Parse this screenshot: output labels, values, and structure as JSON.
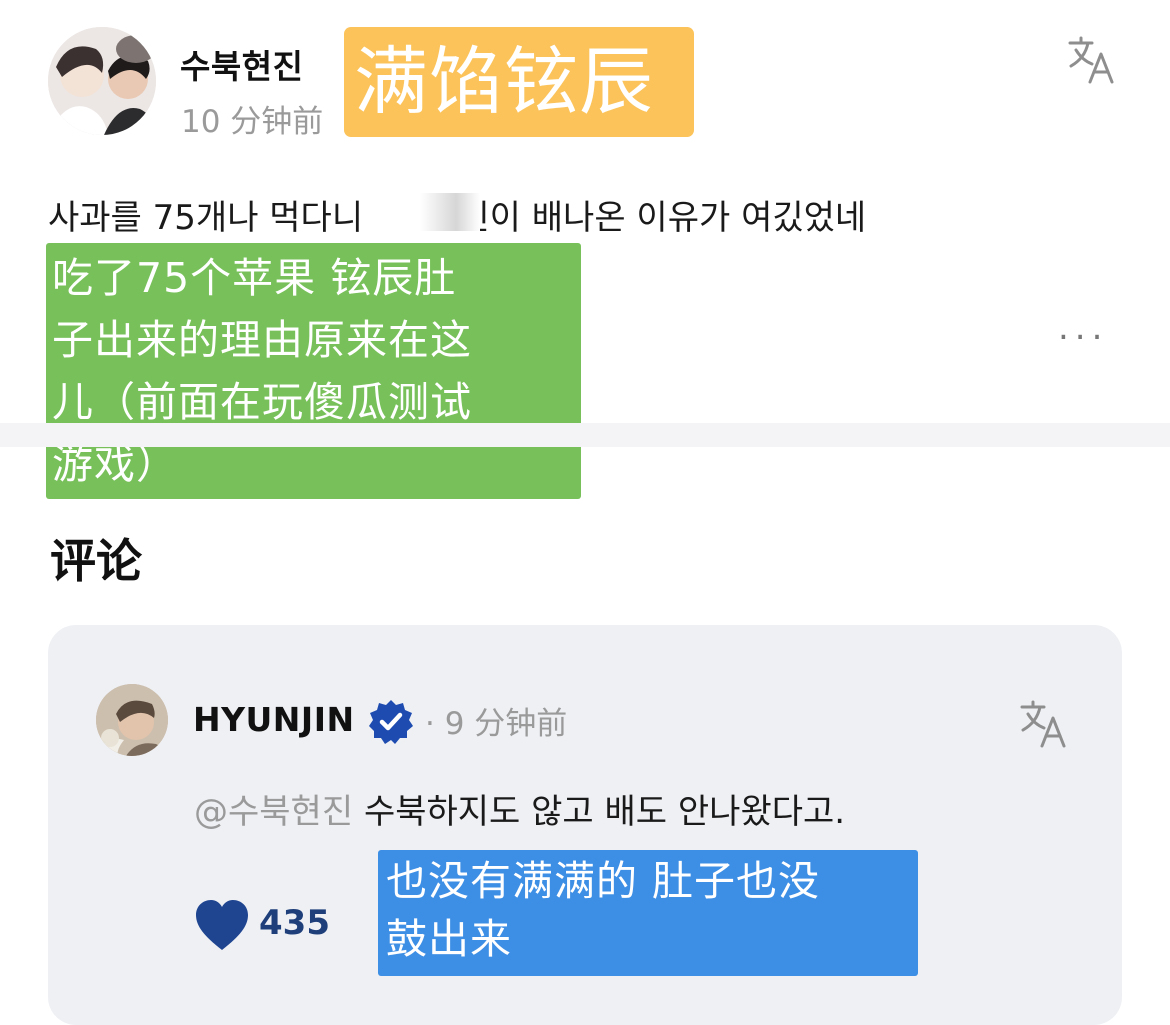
{
  "post": {
    "username": "수북현진",
    "time": "10 分钟前",
    "text_before_blur": "사과를 75개나 먹다니",
    "text_after_blur": "현진이 배나온 이유가 여깄었네",
    "more_label": "..."
  },
  "overlays": {
    "title": "满馅铉辰",
    "post_translation_lines": [
      "吃了75个苹果 铉辰肚",
      "子出来的理由原来在这",
      "儿（前面在玩傻瓜测试",
      "游戏）"
    ],
    "comment_translation_lines": [
      "也没有满满的 肚子也没",
      "鼓出来"
    ]
  },
  "comments_section": {
    "title": "评论"
  },
  "comment": {
    "username": "HYUNJIN",
    "time": "· 9 分钟前",
    "mention": "@수북현진",
    "text": "수북하지도 않고 배도 안나왔다고.",
    "likes": "435"
  },
  "icons": {
    "translate": "translate-icon",
    "verified": "verified-badge-icon",
    "heart": "heart-icon",
    "more": "more-dots-icon"
  },
  "colors": {
    "overlay_orange": "#fbc35a",
    "overlay_green": "#78c15a",
    "overlay_blue": "#3d8ee5",
    "verified_blue": "#1d4bb0",
    "heart_blue": "#1f4591"
  }
}
